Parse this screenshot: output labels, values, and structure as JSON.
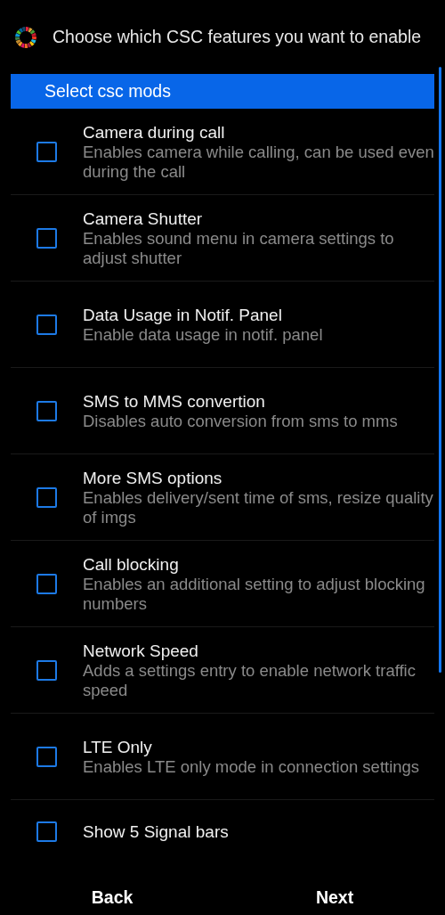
{
  "header": {
    "title": "Choose which CSC features you want to enable"
  },
  "section": {
    "title": "Select csc mods"
  },
  "options": [
    {
      "title": "Camera during call",
      "description": "Enables camera while calling, can be used even during the call",
      "checked": false
    },
    {
      "title": "Camera Shutter",
      "description": "Enables sound menu in camera settings to adjust shutter",
      "checked": false
    },
    {
      "title": "Data Usage in Notif. Panel",
      "description": "Enable data usage in notif. panel",
      "checked": false
    },
    {
      "title": "SMS to MMS convertion",
      "description": "Disables auto conversion from sms to mms",
      "checked": false
    },
    {
      "title": "More SMS options",
      "description": "Enables delivery/sent time of sms, resize quality of imgs",
      "checked": false
    },
    {
      "title": "Call blocking",
      "description": "Enables an additional setting to adjust blocking numbers",
      "checked": false
    },
    {
      "title": "Network Speed",
      "description": "Adds a settings entry to enable network traffic speed",
      "checked": false
    },
    {
      "title": "LTE Only",
      "description": "Enables LTE only mode in connection settings",
      "checked": false
    },
    {
      "title": "Show 5 Signal bars",
      "checked": false
    }
  ],
  "buttons": [
    "Back",
    "Next"
  ]
}
